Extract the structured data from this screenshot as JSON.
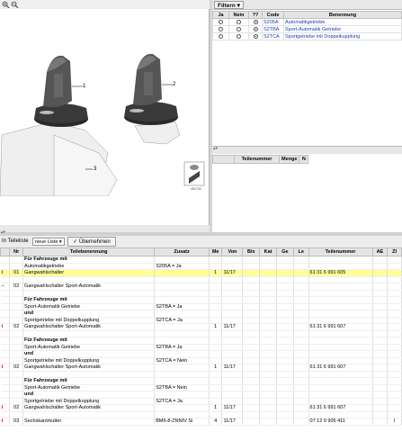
{
  "zoom_toolbar": {
    "zoom_in": "+",
    "zoom_out": "−"
  },
  "drawing": {
    "callouts": [
      "1",
      "2",
      "3"
    ],
    "page_code": "491730"
  },
  "filter": {
    "button_label": "Filtern ▾",
    "columns": [
      "Ja",
      "Nein",
      "??",
      "Code",
      "Benennung"
    ],
    "rows": [
      {
        "ja": false,
        "nein": false,
        "unknown": true,
        "code": "S205A",
        "benennung": "Automatikgetriebe"
      },
      {
        "ja": false,
        "nein": false,
        "unknown": true,
        "code": "S2TBA",
        "benennung": "Sport-Automatik Getriebe"
      },
      {
        "ja": false,
        "nein": false,
        "unknown": true,
        "code": "S2TCA",
        "benennung": "Sportgetriebe mit Doppelkupplung"
      }
    ]
  },
  "parts_list_header": {
    "columns": [
      "",
      "Teilenummer",
      "Menge",
      "N"
    ]
  },
  "toolbar": {
    "label": "In Teileliste",
    "select_value": "neue Liste ▾",
    "button_label": "✓ Übernehmen"
  },
  "main_table": {
    "columns": [
      "",
      "Nr",
      "Teilebenennung",
      "Zusatz",
      "Me",
      "Von",
      "Bis",
      "Kat",
      "Ge",
      "Le",
      "Teilenummer",
      "AE",
      "ZI"
    ],
    "rows": [
      {
        "icon": "",
        "nr": "",
        "name": "Für Fahrzeuge mit",
        "zusatz": "",
        "me": "",
        "von": "",
        "teilenummer": "",
        "zi": "",
        "type": "hdr"
      },
      {
        "icon": "",
        "nr": "",
        "name": "Automatikgetriebe",
        "zusatz": "S205A = Ja",
        "me": "",
        "von": "",
        "teilenummer": "",
        "zi": "",
        "type": ""
      },
      {
        "icon": "i",
        "nr": "01",
        "name": "Gangwahlschalter",
        "zusatz": "",
        "me": "1",
        "von": "11/17",
        "teilenummer": "61 31 6 991 605",
        "zi": "",
        "type": "hl"
      },
      {
        "icon": "",
        "nr": "",
        "name": "",
        "zusatz": "",
        "me": "",
        "von": "",
        "teilenummer": "",
        "zi": "",
        "type": ""
      },
      {
        "icon": "–",
        "nr": "02",
        "name": "Gangwahlschalter Sport-Automatik",
        "zusatz": "",
        "me": "",
        "von": "",
        "teilenummer": "",
        "zi": "",
        "type": ""
      },
      {
        "icon": "",
        "nr": "",
        "name": "",
        "zusatz": "",
        "me": "",
        "von": "",
        "teilenummer": "",
        "zi": "",
        "type": ""
      },
      {
        "icon": "",
        "nr": "",
        "name": "Für Fahrzeuge mit",
        "zusatz": "",
        "me": "",
        "von": "",
        "teilenummer": "",
        "zi": "",
        "type": "hdr"
      },
      {
        "icon": "",
        "nr": "",
        "name": "Sport-Automatik Getriebe",
        "zusatz": "S2TBA = Ja",
        "me": "",
        "von": "",
        "teilenummer": "",
        "zi": "",
        "type": ""
      },
      {
        "icon": "",
        "nr": "",
        "name": "und",
        "zusatz": "",
        "me": "",
        "von": "",
        "teilenummer": "",
        "zi": "",
        "type": "hdr"
      },
      {
        "icon": "",
        "nr": "",
        "name": "Sportgetriebe mit Doppelkupplung",
        "zusatz": "S2TCA = Ja",
        "me": "",
        "von": "",
        "teilenummer": "",
        "zi": "",
        "type": ""
      },
      {
        "icon": "i",
        "nr": "02",
        "name": "Gangwahlschalter Sport-Automatik",
        "zusatz": "",
        "me": "1",
        "von": "11/17",
        "teilenummer": "61 31 6 991 607",
        "zi": "",
        "type": ""
      },
      {
        "icon": "",
        "nr": "",
        "name": "",
        "zusatz": "",
        "me": "",
        "von": "",
        "teilenummer": "",
        "zi": "",
        "type": ""
      },
      {
        "icon": "",
        "nr": "",
        "name": "Für Fahrzeuge mit",
        "zusatz": "",
        "me": "",
        "von": "",
        "teilenummer": "",
        "zi": "",
        "type": "hdr"
      },
      {
        "icon": "",
        "nr": "",
        "name": "Sport-Automatik Getriebe",
        "zusatz": "S2TBA = Ja",
        "me": "",
        "von": "",
        "teilenummer": "",
        "zi": "",
        "type": ""
      },
      {
        "icon": "",
        "nr": "",
        "name": "und",
        "zusatz": "",
        "me": "",
        "von": "",
        "teilenummer": "",
        "zi": "",
        "type": "hdr"
      },
      {
        "icon": "",
        "nr": "",
        "name": "Sportgetriebe mit Doppelkupplung",
        "zusatz": "S2TCA = Nein",
        "me": "",
        "von": "",
        "teilenummer": "",
        "zi": "",
        "type": ""
      },
      {
        "icon": "i",
        "nr": "02",
        "name": "Gangwahlschalter Sport-Automatik",
        "zusatz": "",
        "me": "1",
        "von": "11/17",
        "teilenummer": "61 31 6 991 607",
        "zi": "",
        "type": ""
      },
      {
        "icon": "",
        "nr": "",
        "name": "",
        "zusatz": "",
        "me": "",
        "von": "",
        "teilenummer": "",
        "zi": "",
        "type": ""
      },
      {
        "icon": "",
        "nr": "",
        "name": "Für Fahrzeuge mit",
        "zusatz": "",
        "me": "",
        "von": "",
        "teilenummer": "",
        "zi": "",
        "type": "hdr"
      },
      {
        "icon": "",
        "nr": "",
        "name": "Sport-Automatik Getriebe",
        "zusatz": "S2TBA = Nein",
        "me": "",
        "von": "",
        "teilenummer": "",
        "zi": "",
        "type": ""
      },
      {
        "icon": "",
        "nr": "",
        "name": "und",
        "zusatz": "",
        "me": "",
        "von": "",
        "teilenummer": "",
        "zi": "",
        "type": "hdr"
      },
      {
        "icon": "",
        "nr": "",
        "name": "Sportgetriebe mit Doppelkupplung",
        "zusatz": "S2TCA = Ja",
        "me": "",
        "von": "",
        "teilenummer": "",
        "zi": "",
        "type": ""
      },
      {
        "icon": "i",
        "nr": "02",
        "name": "Gangwahlschalter Sport-Automatik",
        "zusatz": "",
        "me": "1",
        "von": "11/17",
        "teilenummer": "61 31 6 991 607",
        "zi": "",
        "type": ""
      },
      {
        "icon": "",
        "nr": "",
        "name": "",
        "zusatz": "",
        "me": "",
        "von": "",
        "teilenummer": "",
        "zi": "",
        "type": ""
      },
      {
        "icon": "i",
        "nr": "03",
        "name": "Sechskantmutter",
        "zusatz": "BM6-8-ZNNIV Si",
        "me": "4",
        "von": "11/17",
        "teilenummer": "07 12 9 905 411",
        "zi": "I",
        "type": ""
      }
    ]
  },
  "colors": {
    "highlight": "#ffff99",
    "link_blue": "#1a3fb0",
    "info_red": "#cc0000"
  }
}
